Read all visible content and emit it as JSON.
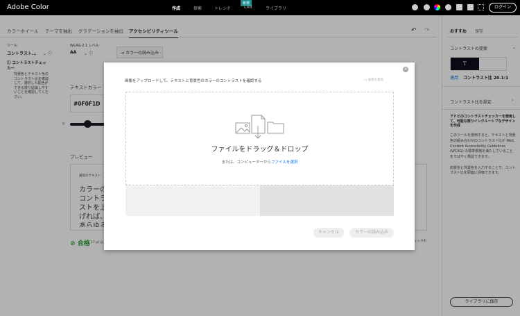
{
  "header": {
    "logo": "Adobe Color",
    "nav": [
      "作成",
      "探索",
      "トレンド",
      "LAB",
      "ライブラリ"
    ],
    "new_badge": "新規",
    "login": "ログイン"
  },
  "tabs": [
    "カラーホイール",
    "テーマを抽出",
    "グラデーションを抽出",
    "アクセシビリティツール"
  ],
  "left": {
    "tool_label": "ツール",
    "tool_value": "コントラスト...",
    "wcag_label": "WCAG 2.1 レベル",
    "wcag_value": "AA",
    "import_btn": "カラーの読み込み",
    "info_title": "コントラストチェッカー",
    "info_body": "背景色とテキスト色のコントラスト比を確認して、選択した配色ができる限り認識しやすいことを確認してください。"
  },
  "main": {
    "text_color_label": "テキストカラー",
    "text_color_value": "#0F0F1D",
    "preview_label": "プレビュー",
    "preview_small": "通常のテキスト",
    "preview_text": "カラーのコントラストを上げれば、あらゆる文字が読みやすくなります",
    "pass": "合格",
    "pass_note": "17 pt 以",
    "bottom_note": "ィックの"
  },
  "right": {
    "tabs": [
      "おすすめ",
      "保存"
    ],
    "suggest": "コントラストの提案",
    "swatch_letter": "T",
    "apply": "適用",
    "ratio": "コントラスト比 20.1:1",
    "set_ratio": "コントラスト比を設定",
    "desc_title": "アドビのコントラストチェッカーを使用して、可能な限りインクルーシブなデザインを作成",
    "desc1": "このツールを使用すると、テキストと背景色の組み合わせのコントラスト比が Web Content Accessibility Guidelines (WCAG) の標準規格を満たしていることをすばやく検証できます。",
    "desc2": "前景色と背景色を入力することで、コントラスト比を即座に評価できます。",
    "save_btn": "ライブラリに保存"
  },
  "modal": {
    "title": "画像をアップロードして、テキストと背景色のカラーのコントラストを確認する",
    "replace": "画像を置換",
    "drop_title": "ファイルをドラッグ＆ドロップ",
    "drop_sub": "または、コンピューターから",
    "drop_link": "ファイルを選択",
    "cancel": "キャンセル",
    "import": "カラーの読み込み"
  }
}
